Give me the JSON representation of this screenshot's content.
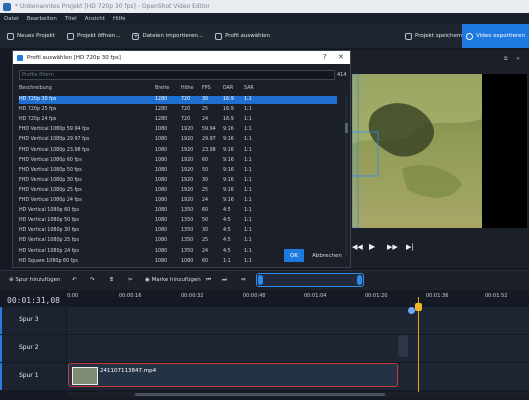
{
  "window": {
    "title": "* Unbenanntes Projekt [HD 720p 30 fps] - OpenShot Video Editor"
  },
  "menu": [
    "Datei",
    "Bearbeiten",
    "Titel",
    "Ansicht",
    "Hilfe"
  ],
  "toolbar": {
    "new_project": "Neues Projekt",
    "open_project": "Projekt öffnen...",
    "import_files": "Dateien importieren...",
    "choose_profile": "Profil auswählen",
    "save_project": "Projekt speichern",
    "export_video": "Video exportieren"
  },
  "dialog": {
    "title": "Profil auswählen [HD 720p 30 fps]",
    "filter_placeholder": "Profile filtern",
    "count": "414",
    "columns": [
      "Beschreibung",
      "Breite",
      "Höhe",
      "FPS",
      "DAR",
      "SAR"
    ],
    "rows": [
      [
        "HD 720p 30 fps",
        "1280",
        "720",
        "30",
        "16:9",
        "1:1"
      ],
      [
        "HD 720p 25 fps",
        "1280",
        "720",
        "25",
        "16:9",
        "1:1"
      ],
      [
        "HD 720p 24 fps",
        "1280",
        "720",
        "24",
        "16:9",
        "1:1"
      ],
      [
        "FHD Vertical 1080p 59.94 fps",
        "1080",
        "1920",
        "59.94",
        "9:16",
        "1:1"
      ],
      [
        "FHD Vertical 1080p 29.97 fps",
        "1080",
        "1920",
        "29.97",
        "9:16",
        "1:1"
      ],
      [
        "FHD Vertical 1080p 23.98 fps",
        "1080",
        "1920",
        "23.98",
        "9:16",
        "1:1"
      ],
      [
        "FHD Vertical 1080p 60 fps",
        "1080",
        "1920",
        "60",
        "9:16",
        "1:1"
      ],
      [
        "FHD Vertical 1080p 50 fps",
        "1080",
        "1920",
        "50",
        "9:16",
        "1:1"
      ],
      [
        "FHD Vertical 1080p 30 fps",
        "1080",
        "1920",
        "30",
        "9:16",
        "1:1"
      ],
      [
        "FHD Vertical 1080p 25 fps",
        "1080",
        "1920",
        "25",
        "9:16",
        "1:1"
      ],
      [
        "FHD Vertical 1080p 24 fps",
        "1080",
        "1920",
        "24",
        "9:16",
        "1:1"
      ],
      [
        "HD Vertical 1080p 60 fps",
        "1080",
        "1350",
        "60",
        "4:5",
        "1:1"
      ],
      [
        "HD Vertical 1080p 50 fps",
        "1080",
        "1350",
        "50",
        "4:5",
        "1:1"
      ],
      [
        "HD Vertical 1080p 30 fps",
        "1080",
        "1350",
        "30",
        "4:5",
        "1:1"
      ],
      [
        "HD Vertical 1080p 25 fps",
        "1080",
        "1350",
        "25",
        "4:5",
        "1:1"
      ],
      [
        "HD Vertical 1080p 24 fps",
        "1080",
        "1350",
        "24",
        "4:5",
        "1:1"
      ],
      [
        "HD Square 1080p 60 fps",
        "1080",
        "1080",
        "60",
        "1:1",
        "1:1"
      ]
    ],
    "ok": "OK",
    "cancel": "Abbrechen"
  },
  "timeline": {
    "add_track": "Spur hinzufügen",
    "add_marker": "Marke hinzufügen",
    "timecode": "00:01:31,08",
    "ruler": [
      "0:00",
      "00:00:16",
      "00:00:32",
      "00:00:48",
      "00:01:04",
      "00:01:20",
      "00:01:36",
      "00:01:52"
    ],
    "tracks": [
      "Spur 3",
      "Spur 2",
      "Spur 1"
    ],
    "clip_name": "241107113847.mp4",
    "playhead_seconds": 91.27
  },
  "icons": {
    "new_project": "new-file-icon",
    "open_project": "folder-icon",
    "import_files": "plus-icon",
    "choose_profile": "film-icon",
    "save_project": "save-icon",
    "export_video": "export-icon"
  },
  "colors": {
    "accent": "#1f7ae0",
    "playhead": "#f0b429",
    "clip_border": "#c83a3a"
  }
}
